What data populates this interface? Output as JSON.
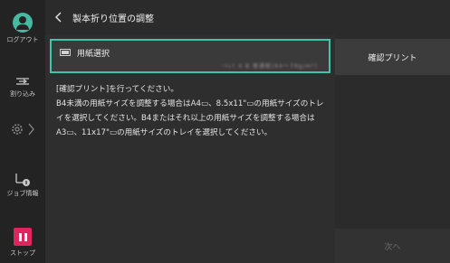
{
  "rail": {
    "logout_label": "ログアウト",
    "interrupt_label": "割り込み",
    "job_label": "ジョブ情報",
    "stop_label": "ストップ"
  },
  "header": {
    "title": "製本折り位置の調整"
  },
  "paper_select": {
    "label": "用紙選択",
    "value": "ｰﾄﾚｲ 4 B  普通紙(64〜79g/m²)"
  },
  "description": "[確認プリント]を行ってください。\nB4未満の用紙サイズを調整する場合はA4▭、8.5x11\"▭の用紙サイズのトレイを選択してください。B4またはそれ以上の用紙サイズを調整する場合はA3▭、11x17\"▭の用紙サイズのトレイを選択してください。",
  "buttons": {
    "confirm_print": "確認プリント",
    "next": "次へ"
  },
  "colors": {
    "accent": "#41c4ac",
    "stop": "#e0245e"
  }
}
